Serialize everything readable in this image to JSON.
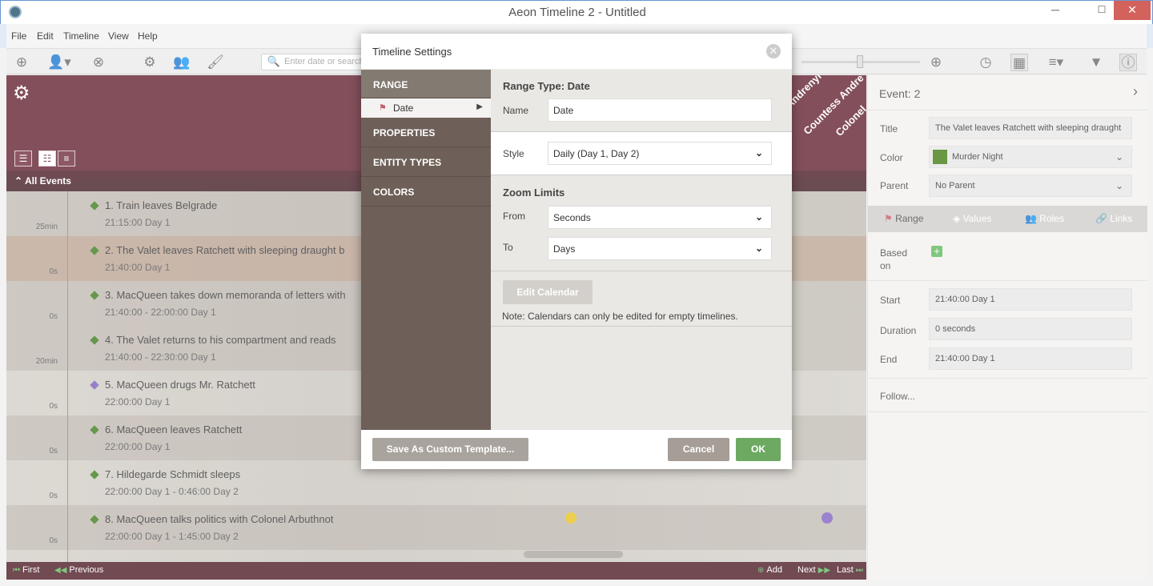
{
  "window": {
    "title": "Aeon Timeline 2 - Untitled",
    "min": "─",
    "max": "☐",
    "close": "✕"
  },
  "menu": [
    "File",
    "Edit",
    "Timeline",
    "View",
    "Help"
  ],
  "toolbar": {
    "search_placeholder": "Enter date or search"
  },
  "timeline": {
    "all_events_label": "All Events",
    "header_labels": [
      "nt Andrenyi",
      "Countess Andre",
      "Colonel"
    ],
    "tick_labels": [
      "25min",
      "0s",
      "0s",
      "20min",
      "0s",
      "0s",
      "0s",
      "0s"
    ],
    "events": [
      {
        "title": "1. Train leaves Belgrade",
        "time": "21:15:00 Day 1"
      },
      {
        "title": "2. The Valet leaves Ratchett with sleeping draught b",
        "time": "21:40:00 Day 1"
      },
      {
        "title": "3. MacQueen takes down memoranda of letters with",
        "time": "21:40:00 - 22:00:00 Day 1"
      },
      {
        "title": "4. The Valet returns to his compartment and reads",
        "time": "21:40:00 - 22:30:00 Day 1"
      },
      {
        "title": "5. MacQueen drugs Mr. Ratchett",
        "time": "22:00:00 Day 1"
      },
      {
        "title": "6. MacQueen leaves Ratchett",
        "time": "22:00:00 Day 1"
      },
      {
        "title": "7. Hildegarde Schmidt sleeps",
        "time": "22:00:00 Day 1 - 0:46:00 Day 2"
      },
      {
        "title": "8. MacQueen talks politics with Colonel Arbuthnot",
        "time": "22:00:00 Day 1 - 1:45:00 Day 2"
      }
    ],
    "nav": {
      "first": "First",
      "previous": "Previous",
      "add": "Add",
      "next": "Next",
      "last": "Last"
    },
    "colors": {
      "header": "#611e2e",
      "green": "#3a7a1a",
      "purple": "#7a5ab8",
      "yellow": "#e8c21e"
    }
  },
  "inspector": {
    "title": "Event: 2",
    "fields": {
      "title_label": "Title",
      "title_value": "The Valet leaves Ratchett with sleeping draught",
      "color_label": "Color",
      "color_value": "Murder Night",
      "parent_label": "Parent",
      "parent_value": "No Parent"
    },
    "tabs": [
      "Range",
      "Values",
      "Roles",
      "Links"
    ],
    "based_on_label": "Based on",
    "start_label": "Start",
    "start_value": "21:40:00 Day 1",
    "duration_label": "Duration",
    "duration_value": "0 seconds",
    "end_label": "End",
    "end_value": "21:40:00 Day 1",
    "follow_label": "Follow..."
  },
  "dialog": {
    "title": "Timeline Settings",
    "sidebar": {
      "range": "RANGE",
      "date": "Date",
      "properties": "PROPERTIES",
      "entity_types": "ENTITY TYPES",
      "colors": "COLORS"
    },
    "range_type_title": "Range Type: Date",
    "name_label": "Name",
    "name_value": "Date",
    "style_label": "Style",
    "style_value": "Daily (Day 1, Day 2)",
    "zoom_title": "Zoom Limits",
    "from_label": "From",
    "from_value": "Seconds",
    "to_label": "To",
    "to_value": "Days",
    "edit_calendar": "Edit Calendar",
    "note": "Note: Calendars can only be edited for empty timelines.",
    "save_template": "Save As Custom Template...",
    "cancel": "Cancel",
    "ok": "OK"
  }
}
